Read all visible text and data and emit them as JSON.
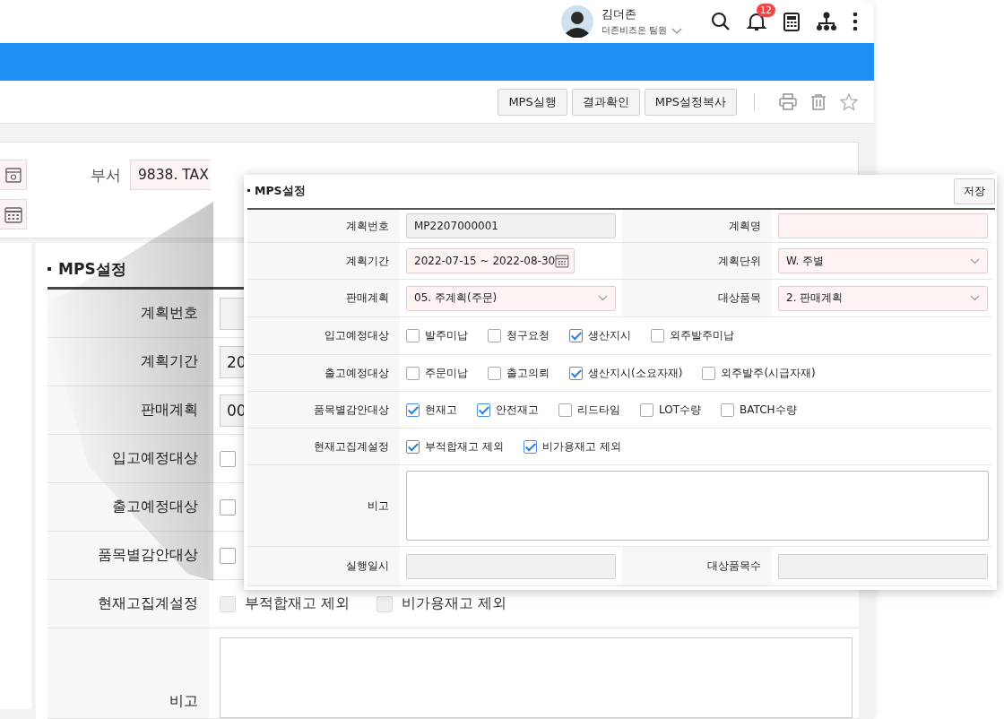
{
  "header": {
    "user_name": "김더존",
    "user_team": "더존비즈온 팀원",
    "notification_count": "12"
  },
  "toolbar": {
    "buttons": [
      "MPS실행",
      "결과확인",
      "MPS설정복사"
    ]
  },
  "background_form": {
    "dept_label": "부서",
    "dept_value": "9838. TAX",
    "section_title": "MPS설정",
    "rows": [
      {
        "label": "계획번호",
        "kind": "text"
      },
      {
        "label": "계획기간",
        "kind": "text",
        "value": "20"
      },
      {
        "label": "판매계획",
        "kind": "text",
        "value": "00"
      },
      {
        "label": "입고예정대상",
        "kind": "checks",
        "options": [
          {
            "checked": false,
            "disabled": false
          }
        ]
      },
      {
        "label": "출고예정대상",
        "kind": "checks",
        "options": [
          {
            "checked": false,
            "disabled": false
          }
        ]
      },
      {
        "label": "품목별감안대상",
        "kind": "checks",
        "options": [
          {
            "checked": false,
            "disabled": false
          }
        ]
      },
      {
        "label": "현재고집계설정",
        "kind": "checks",
        "options": [
          {
            "label": "부적합재고 제외",
            "checked": false,
            "disabled": true
          },
          {
            "label": "비가용재고 제외",
            "checked": false,
            "disabled": true
          }
        ]
      },
      {
        "label": "비고",
        "kind": "textarea"
      }
    ]
  },
  "mps_panel": {
    "title": "MPS설정",
    "save_button": "저장",
    "rows": [
      {
        "cells": [
          {
            "label": "계획번호",
            "kind": "text",
            "readonly": true,
            "required": false,
            "value": "MP2207000001"
          },
          {
            "label": "계획명",
            "kind": "text",
            "readonly": false,
            "required": true
          }
        ]
      },
      {
        "cells": [
          {
            "label": "계획기간",
            "kind": "date",
            "readonly": false,
            "required": true,
            "value": "2022-07-15 ~ 2022-08-30"
          },
          {
            "label": "계획단위",
            "kind": "select",
            "readonly": false,
            "required": true,
            "value": "W. 주별"
          }
        ]
      },
      {
        "cells": [
          {
            "label": "판매계획",
            "kind": "select",
            "readonly": false,
            "required": true,
            "value": "05. 주계획(주문)"
          },
          {
            "label": "대상품목",
            "kind": "select",
            "readonly": false,
            "required": true,
            "value": "2. 판매계획"
          }
        ]
      },
      {
        "cells": [
          {
            "label": "입고예정대상",
            "kind": "checks",
            "options": [
              {
                "label": "발주미납",
                "checked": false
              },
              {
                "label": "청구요청",
                "checked": false
              },
              {
                "label": "생산지시",
                "checked": true
              },
              {
                "label": "외주발주미납",
                "checked": false
              }
            ]
          }
        ]
      },
      {
        "cells": [
          {
            "label": "출고예정대상",
            "kind": "checks",
            "options": [
              {
                "label": "주문미납",
                "checked": false
              },
              {
                "label": "출고의뢰",
                "checked": false
              },
              {
                "label": "생산지시(소요자재)",
                "checked": true
              },
              {
                "label": "외주발주(시급자재)",
                "checked": false
              }
            ]
          }
        ]
      },
      {
        "cells": [
          {
            "label": "품목별감안대상",
            "kind": "checks",
            "options": [
              {
                "label": "현재고",
                "checked": true
              },
              {
                "label": "안전재고",
                "checked": true
              },
              {
                "label": "리드타임",
                "checked": false
              },
              {
                "label": "LOT수량",
                "checked": false
              },
              {
                "label": "BATCH수량",
                "checked": false
              }
            ]
          }
        ]
      },
      {
        "cells": [
          {
            "label": "현재고집계설정",
            "kind": "checks",
            "options": [
              {
                "label": "부적합재고 제외",
                "checked": true
              },
              {
                "label": "비가용재고 제외",
                "checked": true
              }
            ]
          }
        ]
      },
      {
        "cells": [
          {
            "label": "비고",
            "kind": "textarea",
            "readonly": false,
            "required": false
          }
        ]
      },
      {
        "cells": [
          {
            "label": "실행일시",
            "kind": "text",
            "readonly": true,
            "required": false
          },
          {
            "label": "대상품목수",
            "kind": "text",
            "readonly": true,
            "required": false
          }
        ]
      }
    ]
  }
}
